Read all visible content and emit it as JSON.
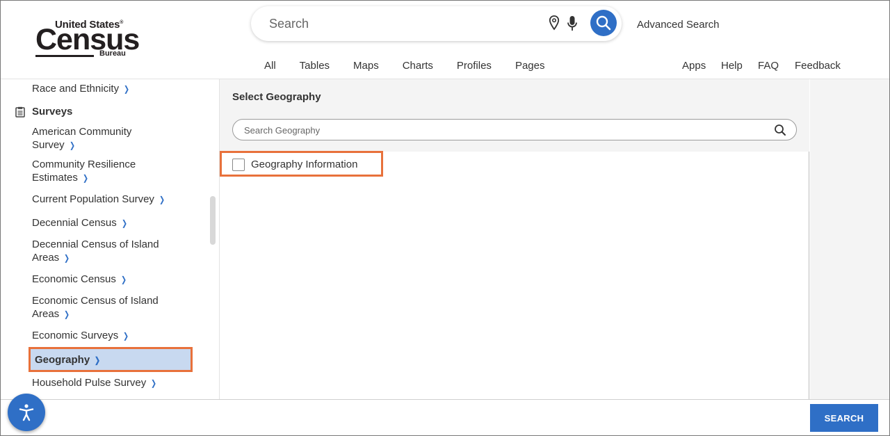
{
  "logo": {
    "line1": "United States",
    "registered": "®",
    "line2": "Census",
    "line3": "Bureau"
  },
  "search": {
    "placeholder": "Search",
    "advanced_label": "Advanced Search"
  },
  "tabs": [
    "All",
    "Tables",
    "Maps",
    "Charts",
    "Profiles",
    "Pages"
  ],
  "utility_links": [
    "Apps",
    "Help",
    "FAQ",
    "Feedback"
  ],
  "sidebar": {
    "top_item": "Race and Ethnicity",
    "heading": "Surveys",
    "items": [
      "American Community Survey",
      "Community Resilience Estimates",
      "Current Population Survey",
      "Decennial Census",
      "Decennial Census of Island Areas",
      "Economic Census",
      "Economic Census of Island Areas",
      "Economic Surveys",
      "Geography",
      "Household Pulse Survey"
    ],
    "selected": "Geography"
  },
  "panel": {
    "title": "Select Geography",
    "search_placeholder": "Search Geography",
    "options": [
      "Geography Information"
    ]
  },
  "footer": {
    "search_button": "SEARCH"
  },
  "colors": {
    "accent": "#2f6fc6",
    "highlight": "#e8713b",
    "selected_bg": "#c8d9f0"
  }
}
